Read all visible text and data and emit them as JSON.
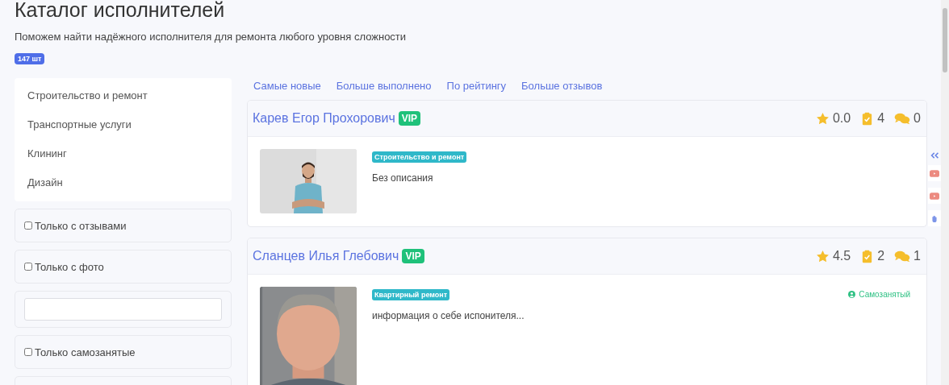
{
  "page": {
    "title": "Каталог исполнителей",
    "subtitle": "Поможем найти надёжного исполнителя для ремонта любого уровня сложности",
    "count_badge": "147 шт"
  },
  "categories": [
    {
      "label": "Строительство и ремонт"
    },
    {
      "label": "Транспортные услуги"
    },
    {
      "label": "Клининг"
    },
    {
      "label": "Дизайн"
    }
  ],
  "filters": [
    {
      "kind": "checkbox",
      "label": "Только с отзывами",
      "checked": false
    },
    {
      "kind": "checkbox",
      "label": "Только с фото",
      "checked": false
    },
    {
      "kind": "input"
    },
    {
      "kind": "checkbox",
      "label": "Только самозанятые",
      "checked": false
    },
    {
      "kind": "empty"
    }
  ],
  "sort_links": [
    "Самые новые",
    "Больше выполнено",
    "По рейтингу",
    "Больше отзывов"
  ],
  "performers": [
    {
      "name": "Карев Егор Прохорович",
      "vip": true,
      "vip_label": "VIP",
      "rating": "0.0",
      "tasks": "4",
      "reviews": "0",
      "category": "Строительство и ремонт",
      "description": "Без описания"
    },
    {
      "name": "Сланцев Илья Глебович",
      "vip": true,
      "vip_label": "VIP",
      "rating": "4.5",
      "tasks": "2",
      "reviews": "1",
      "category": "Квартирный ремонт",
      "description": "информация о себе испонителя...",
      "self_employed": "Самозанятый"
    }
  ]
}
